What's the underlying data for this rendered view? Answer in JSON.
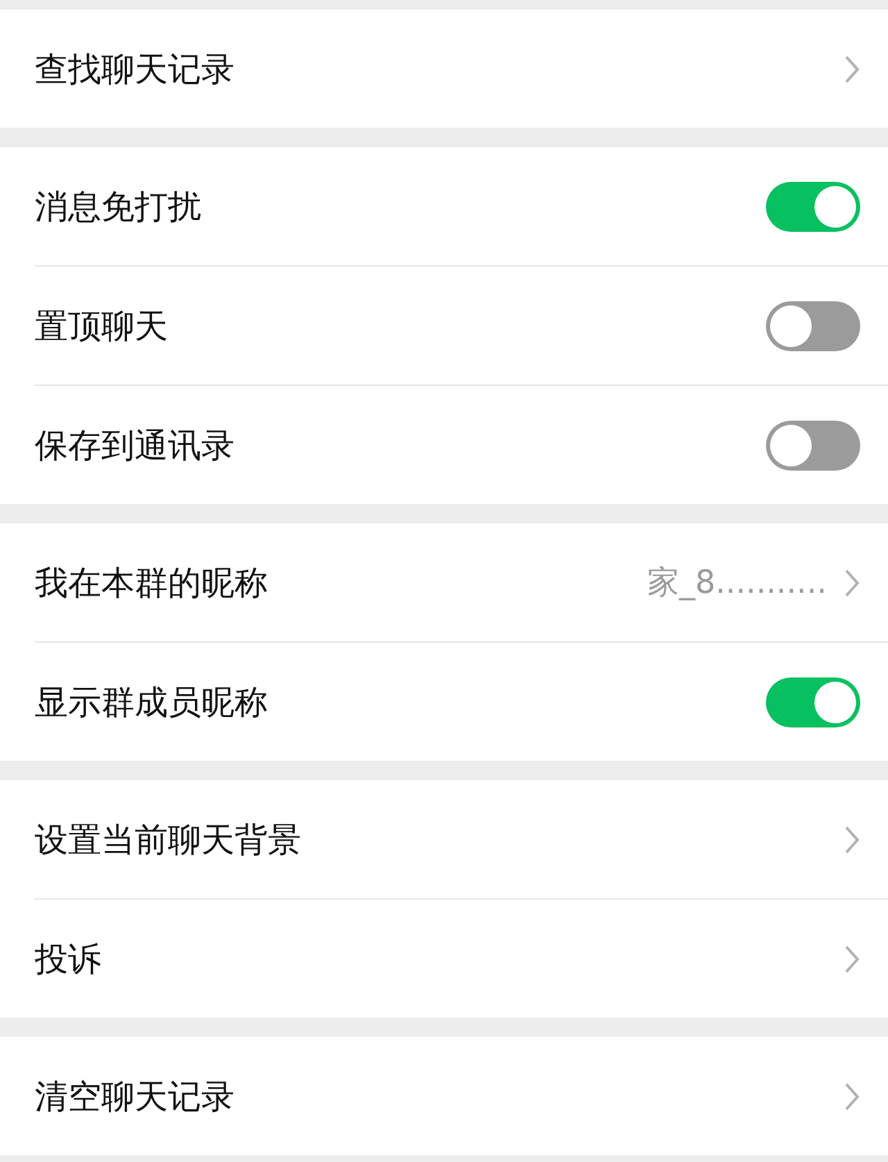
{
  "sections": [
    {
      "items": [
        {
          "kind": "link",
          "label": "查找聊天记录"
        }
      ]
    },
    {
      "items": [
        {
          "kind": "switch",
          "label": "消息免打扰",
          "on": true
        },
        {
          "kind": "switch",
          "label": "置顶聊天",
          "on": false
        },
        {
          "kind": "switch",
          "label": "保存到通讯录",
          "on": false
        }
      ]
    },
    {
      "items": [
        {
          "kind": "link",
          "label": "我在本群的昵称",
          "value": "家_8..........."
        },
        {
          "kind": "switch",
          "label": "显示群成员昵称",
          "on": true
        }
      ]
    },
    {
      "items": [
        {
          "kind": "link",
          "label": "设置当前聊天背景"
        },
        {
          "kind": "link",
          "label": "投诉"
        }
      ]
    },
    {
      "items": [
        {
          "kind": "link",
          "label": "清空聊天记录"
        }
      ]
    }
  ]
}
